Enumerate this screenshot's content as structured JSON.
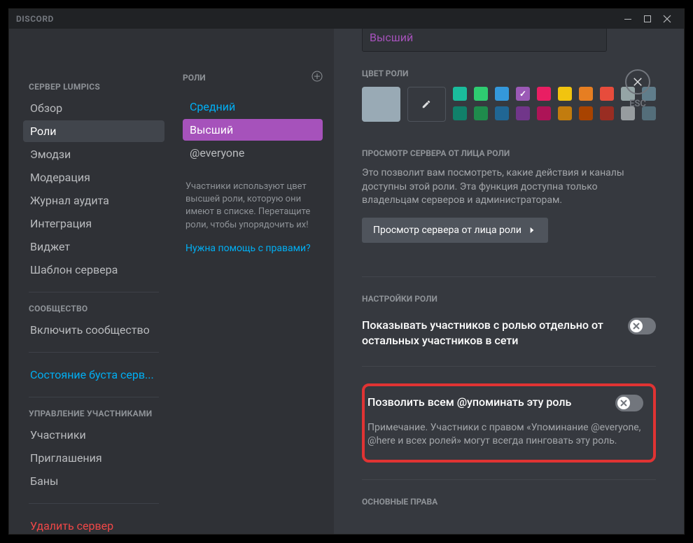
{
  "app_name": "DISCORD",
  "close_label": "ESC",
  "sidebar": {
    "server_header": "СЕРВЕР LUMPICS",
    "items_main": [
      "Обзор",
      "Роли",
      "Эмодзи",
      "Модерация",
      "Журнал аудита",
      "Интеграция",
      "Виджет",
      "Шаблон сервера"
    ],
    "community_header": "СООБЩЕСТВО",
    "community_item": "Включить сообщество",
    "boost_status": "Состояние буста серв...",
    "members_header": "УПРАВЛЕНИЕ УЧАСТНИКАМИ",
    "members_items": [
      "Участники",
      "Приглашения",
      "Баны"
    ],
    "delete_server": "Удалить сервер"
  },
  "roles_panel": {
    "title": "РОЛИ",
    "items": [
      "Средний",
      "Высший",
      "@everyone"
    ],
    "help_text": "Участники используют цвет высшей роли, которую они имеют в списке. Перетащите роли, чтобы упорядочить их!",
    "help_link": "Нужна помощь с правами?"
  },
  "main": {
    "role_name_value": "Высший",
    "color_label": "ЦВЕТ РОЛИ",
    "colors_row1": [
      "#1abc9c",
      "#2ecc71",
      "#3498db",
      "#9b59b6",
      "#e91e63",
      "#f1c40f",
      "#e67e22",
      "#e74c3c",
      "#95a5a6",
      "#607d8b"
    ],
    "colors_row2": [
      "#11806a",
      "#1f8b4c",
      "#206694",
      "#71368a",
      "#ad1457",
      "#c27c0e",
      "#a84300",
      "#992d22",
      "#979c9f",
      "#546e7a"
    ],
    "selected_color_index": 3,
    "view_as_role_header": "ПРОСМОТР СЕРВЕРА ОТ ЛИЦА РОЛИ",
    "view_as_role_desc": "Это позволит вам посмотреть, какие действия и каналы доступны этой роли. Эта функция доступна только владельцам серверов и администраторам.",
    "view_as_role_button": "Просмотр сервера от лица роли",
    "role_settings_header": "НАСТРОЙКИ РОЛИ",
    "display_separately": "Показывать участников с ролью отдельно от остальных участников в сети",
    "allow_mention": "Позволить всем @упоминать эту роль",
    "allow_mention_note": "Примечание. Участники с правом «Упоминание @everyone, @here и всех ролей» могут всегда пинговать эту роль.",
    "general_permissions_header": "ОСНОВНЫЕ ПРАВА"
  }
}
